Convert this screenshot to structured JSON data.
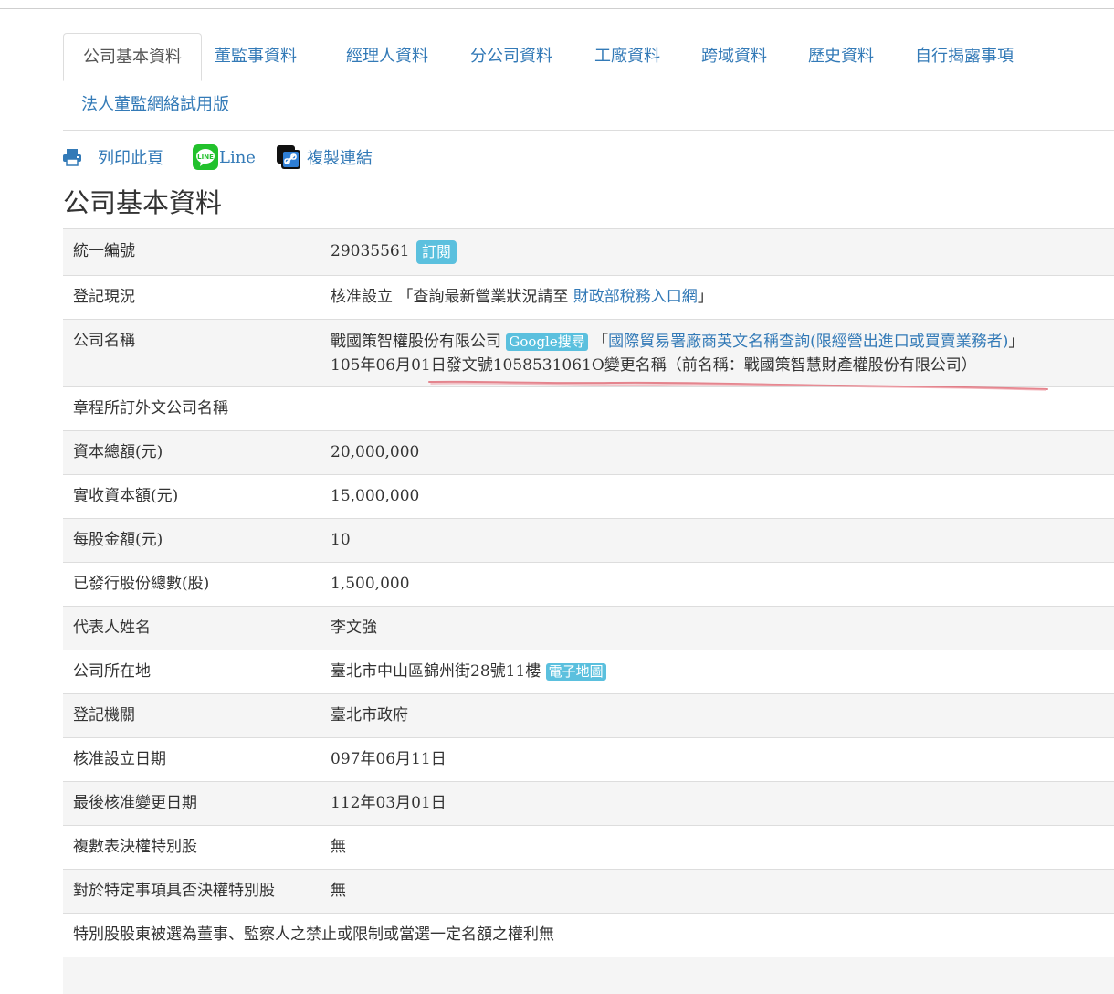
{
  "tabs": [
    {
      "label": "公司基本資料",
      "active": true
    },
    {
      "label": "董監事資料"
    },
    {
      "label": "經理人資料"
    },
    {
      "label": "分公司資料"
    },
    {
      "label": "工廠資料"
    },
    {
      "label": "跨域資料"
    },
    {
      "label": "歷史資料"
    },
    {
      "label": "自行揭露事項"
    },
    {
      "label": "法人董監網絡試用版"
    }
  ],
  "actions": {
    "print": "列印此頁",
    "line": "Line",
    "line_icon_text": "LINE",
    "copy_link": "複製連結"
  },
  "page_title": "公司基本資料",
  "rows": {
    "tax_id": {
      "label": "統一編號",
      "value": "29035561",
      "badge": "訂閱"
    },
    "status": {
      "label": "登記現況",
      "prefix": "核准設立 「查詢最新營業狀況請至 ",
      "link": "財政部稅務入口網",
      "suffix": "」"
    },
    "company_name": {
      "label": "公司名稱",
      "name": "戰國策智權股份有限公司",
      "google_badge": "Google搜尋",
      "english_link_prefix": "「",
      "english_link": "國際貿易署廠商英文名稱查詢(限經營出進口或買賣業務者)",
      "english_link_suffix": "」",
      "change_note": "105年06月01日發文號1058531061O變更名稱（前名稱：戰國策智慧財產權股份有限公司）"
    },
    "foreign_name": {
      "label": "章程所訂外文公司名稱",
      "value": ""
    },
    "capital_total": {
      "label": "資本總額(元)",
      "value": "20,000,000"
    },
    "capital_paid": {
      "label": "實收資本額(元)",
      "value": "15,000,000"
    },
    "par_value": {
      "label": "每股金額(元)",
      "value": "10"
    },
    "shares_issued": {
      "label": "已發行股份總數(股)",
      "value": "1,500,000"
    },
    "representative": {
      "label": "代表人姓名",
      "value": "李文強"
    },
    "address": {
      "label": "公司所在地",
      "value": "臺北市中山區錦州街28號11樓",
      "badge": "電子地圖"
    },
    "authority": {
      "label": "登記機關",
      "value": "臺北市政府"
    },
    "approval_date": {
      "label": "核准設立日期",
      "value": "097年06月11日"
    },
    "last_change_date": {
      "label": "最後核准變更日期",
      "value": "112年03月01日"
    },
    "multi_vote_shares": {
      "label": "複數表決權特別股",
      "value": "無"
    },
    "veto_shares": {
      "label": "對於特定事項具否決權特別股",
      "value": "無"
    },
    "director_restriction": {
      "label": "特別股股東被選為董事、監察人之禁止或限制或當選一定名額之權利",
      "value": "無"
    }
  }
}
